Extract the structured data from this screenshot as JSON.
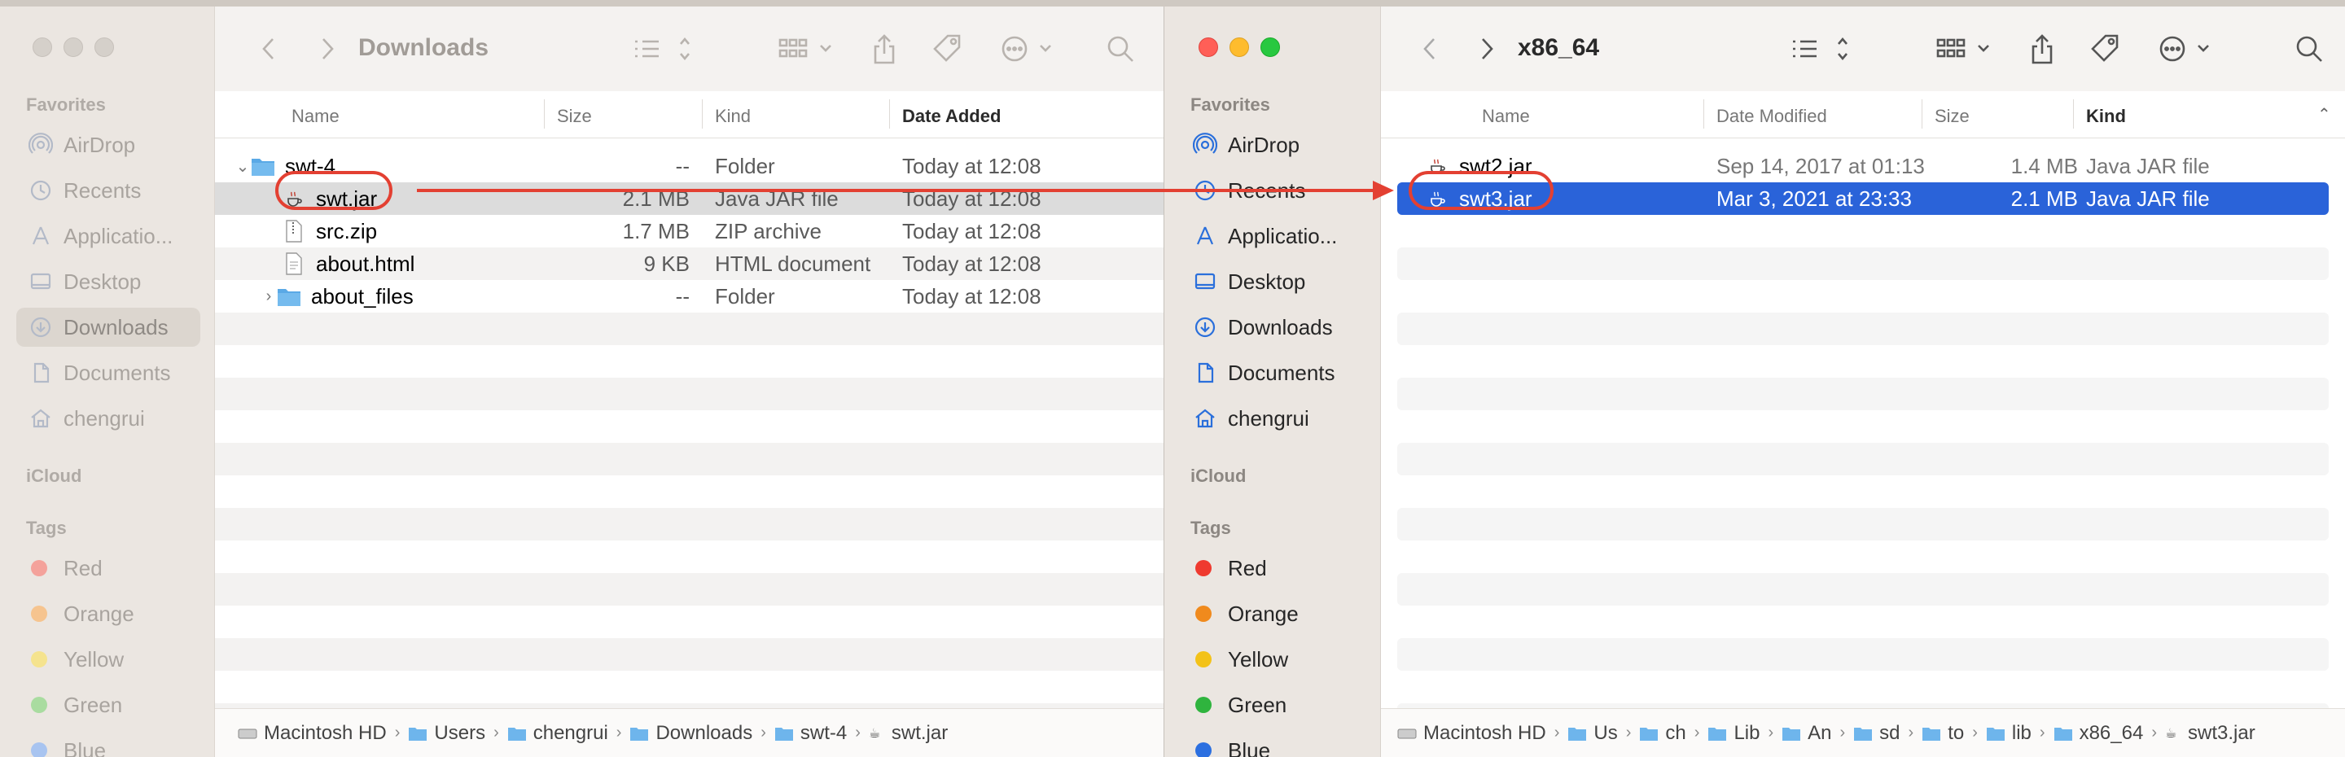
{
  "left_window": {
    "title": "Downloads",
    "sidebar": {
      "favorites_heading": "Favorites",
      "favorites": [
        "AirDrop",
        "Recents",
        "Applicatio...",
        "Desktop",
        "Downloads",
        "Documents",
        "chengrui"
      ],
      "icloud_heading": "iCloud",
      "tags_heading": "Tags",
      "tags": [
        {
          "label": "Red",
          "color": "#f4a29b"
        },
        {
          "label": "Orange",
          "color": "#f6c48f"
        },
        {
          "label": "Yellow",
          "color": "#f5e38e"
        },
        {
          "label": "Green",
          "color": "#a9dca0"
        },
        {
          "label": "Blue",
          "color": "#a8c4f0"
        }
      ]
    },
    "columns": {
      "name": "Name",
      "size": "Size",
      "kind": "Kind",
      "date": "Date Added"
    },
    "rows": [
      {
        "name": "swt-4",
        "size": "--",
        "kind": "Folder",
        "date": "Today at 12:08"
      },
      {
        "name": "swt.jar",
        "size": "2.1 MB",
        "kind": "Java JAR file",
        "date": "Today at 12:08"
      },
      {
        "name": "src.zip",
        "size": "1.7 MB",
        "kind": "ZIP archive",
        "date": "Today at 12:08"
      },
      {
        "name": "about.html",
        "size": "9 KB",
        "kind": "HTML document",
        "date": "Today at 12:08"
      },
      {
        "name": "about_files",
        "size": "--",
        "kind": "Folder",
        "date": "Today at 12:08"
      }
    ],
    "path": [
      "Macintosh HD",
      "Users",
      "chengrui",
      "Downloads",
      "swt-4",
      "swt.jar"
    ]
  },
  "right_window": {
    "title": "x86_64",
    "sidebar": {
      "favorites_heading": "Favorites",
      "favorites": [
        "AirDrop",
        "Recents",
        "Applicatio...",
        "Desktop",
        "Downloads",
        "Documents",
        "chengrui"
      ],
      "icloud_heading": "iCloud",
      "tags_heading": "Tags",
      "tags": [
        {
          "label": "Red",
          "color": "#ef3a2f"
        },
        {
          "label": "Orange",
          "color": "#f08a1d"
        },
        {
          "label": "Yellow",
          "color": "#f3c218"
        },
        {
          "label": "Green",
          "color": "#2fb43e"
        },
        {
          "label": "Blue",
          "color": "#2b6fe0"
        }
      ]
    },
    "columns": {
      "name": "Name",
      "date": "Date Modified",
      "size": "Size",
      "kind": "Kind"
    },
    "rows": [
      {
        "name": "swt2.jar",
        "date": "Sep 14, 2017 at 01:13",
        "size": "1.4 MB",
        "kind": "Java JAR file"
      },
      {
        "name": "swt3.jar",
        "date": "Mar 3, 2021 at 23:33",
        "size": "2.1 MB",
        "kind": "Java JAR file"
      }
    ],
    "path": [
      "Macintosh HD",
      "Us",
      "ch",
      "Lib",
      "An",
      "sd",
      "to",
      "lib",
      "x86_64",
      "swt3.jar"
    ]
  },
  "colors": {
    "accent": "#2a63d9",
    "annotation": "#e34032"
  }
}
